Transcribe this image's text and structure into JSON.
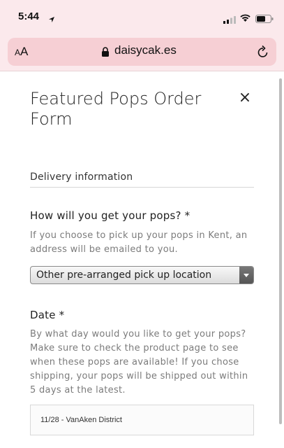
{
  "status_bar": {
    "time": "5:44"
  },
  "browser": {
    "aa_small": "A",
    "aa_big": "A",
    "url": "daisycak.es"
  },
  "form": {
    "title": "Featured Pops Order Form",
    "close_label": "×",
    "section_heading": "Delivery information",
    "delivery": {
      "label": "How will you get your pops? *",
      "help": "If you choose to pick up your pops in Kent, an address will be emailed to you.",
      "selected_option": "Other pre-arranged pick up location"
    },
    "date": {
      "label": "Date *",
      "help": "By what day would you like to get your pops? Make sure to check the product page to see when these pops are available! If you chose shipping, your pops will be shipped out within 5 days at the latest.",
      "value": "11/28 - VanAken District"
    }
  },
  "colors": {
    "browser_chrome": "#fbe9ec",
    "url_pill": "#f6cfd4"
  }
}
